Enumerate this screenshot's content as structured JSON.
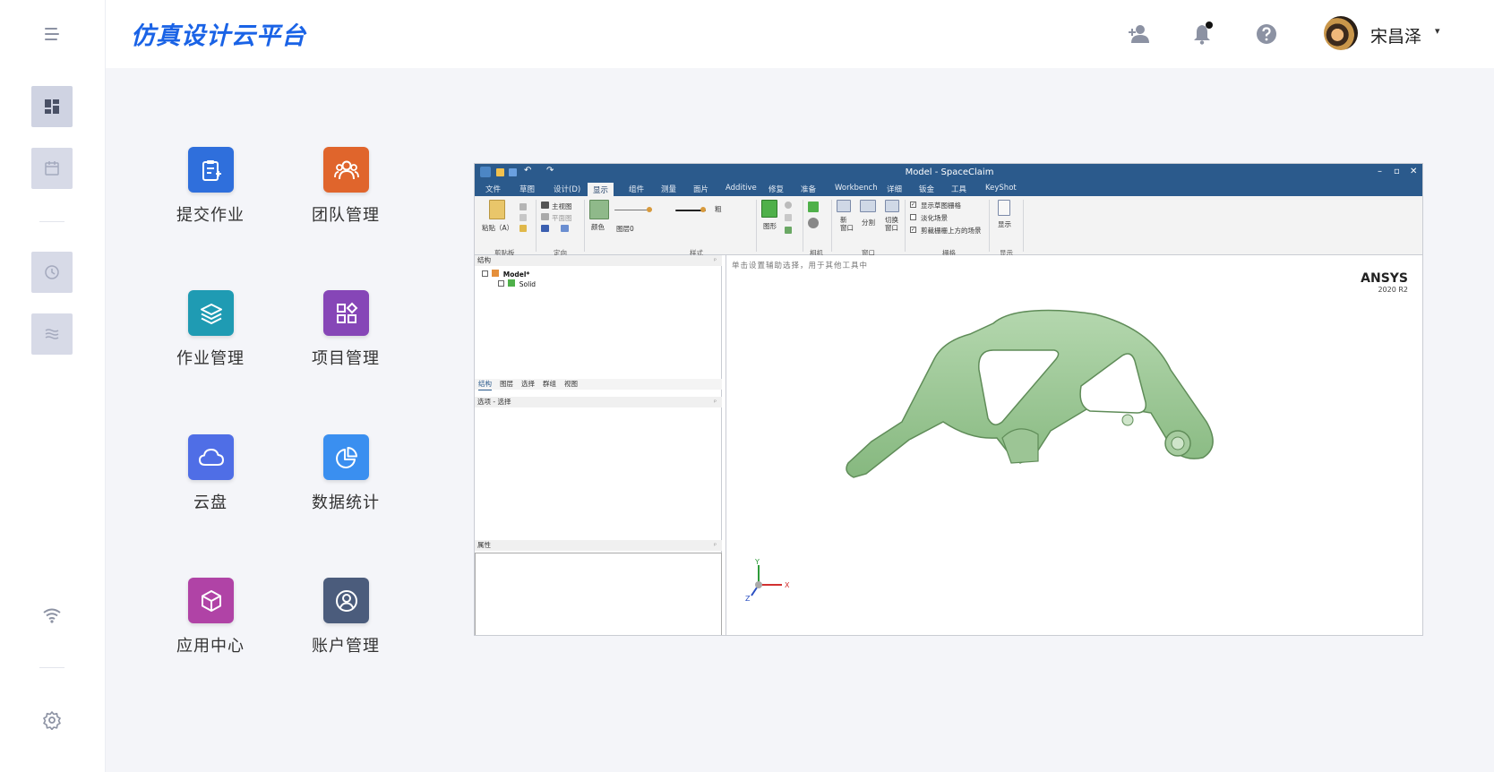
{
  "header": {
    "brand": "仿真设计云平台",
    "user_name": "宋昌泽",
    "user_caret": "▾",
    "icons": [
      "add-user-icon",
      "bell-icon",
      "help-icon"
    ]
  },
  "sidebar": {
    "items": [
      "dashboard-icon",
      "calendar-icon",
      "history-icon",
      "layers-icon",
      "wifi-icon",
      "gear-icon"
    ]
  },
  "apps": [
    {
      "label": "提交作业",
      "color": "#2f6fdc",
      "icon": "submit-job-icon"
    },
    {
      "label": "团队管理",
      "color": "#e0652c",
      "icon": "team-icon"
    },
    {
      "label": "作业管理",
      "color": "#1f9bb3",
      "icon": "stack-icon"
    },
    {
      "label": "项目管理",
      "color": "#8646b7",
      "icon": "apps-icon"
    },
    {
      "label": "云盘",
      "color": "#4f6ee6",
      "icon": "cloud-icon"
    },
    {
      "label": "数据统计",
      "color": "#3a8ff0",
      "icon": "pie-icon"
    },
    {
      "label": "应用中心",
      "color": "#b043a6",
      "icon": "box-icon"
    },
    {
      "label": "账户管理",
      "color": "#4b5c7c",
      "icon": "account-icon"
    }
  ],
  "spaceclaim": {
    "title": "Model - SpaceClaim",
    "window_controls": [
      "–",
      "▫",
      "✕"
    ],
    "tabs": [
      "文件",
      "草图",
      "设计(D)",
      "显示",
      "组件",
      "测量",
      "面片",
      "Additive",
      "修复",
      "准备",
      "Workbench",
      "详细",
      "钣金",
      "工具",
      "KeyShot"
    ],
    "active_tab": "显示",
    "ribbon": {
      "paste": "粘贴（A）",
      "group_clipboard": "剪贴板",
      "main_view": "主视图",
      "plane_view": "平面图",
      "group_orient": "定向",
      "color": "颜色",
      "layer": "图层0",
      "thick": "粗",
      "group_style": "样式",
      "shape": "图形",
      "group_camera": "相机",
      "new_window": "新\n窗口",
      "split": "分割",
      "switch_window": "切换\n窗口",
      "group_window": "窗口",
      "show_grid": "显示草图栅格",
      "fade_scene": "淡化场景",
      "clip_above": "剪裁栅栅上方的场景",
      "group_grid": "栅格",
      "display": "显示",
      "group_display": "显示"
    },
    "structure_header": "结构",
    "tree": [
      "Model*",
      "Solid"
    ],
    "subtabs": [
      "结构",
      "图层",
      "选择",
      "群组",
      "视图"
    ],
    "options_header": "选项 - 选择",
    "properties_header": "属性",
    "view_hint": "单击设置辅助选择，用于其他工具中",
    "ansys": "ANSYS",
    "ansys_version": "2020 R2",
    "axes": {
      "x": "X",
      "y": "Y",
      "z": "Z"
    }
  }
}
